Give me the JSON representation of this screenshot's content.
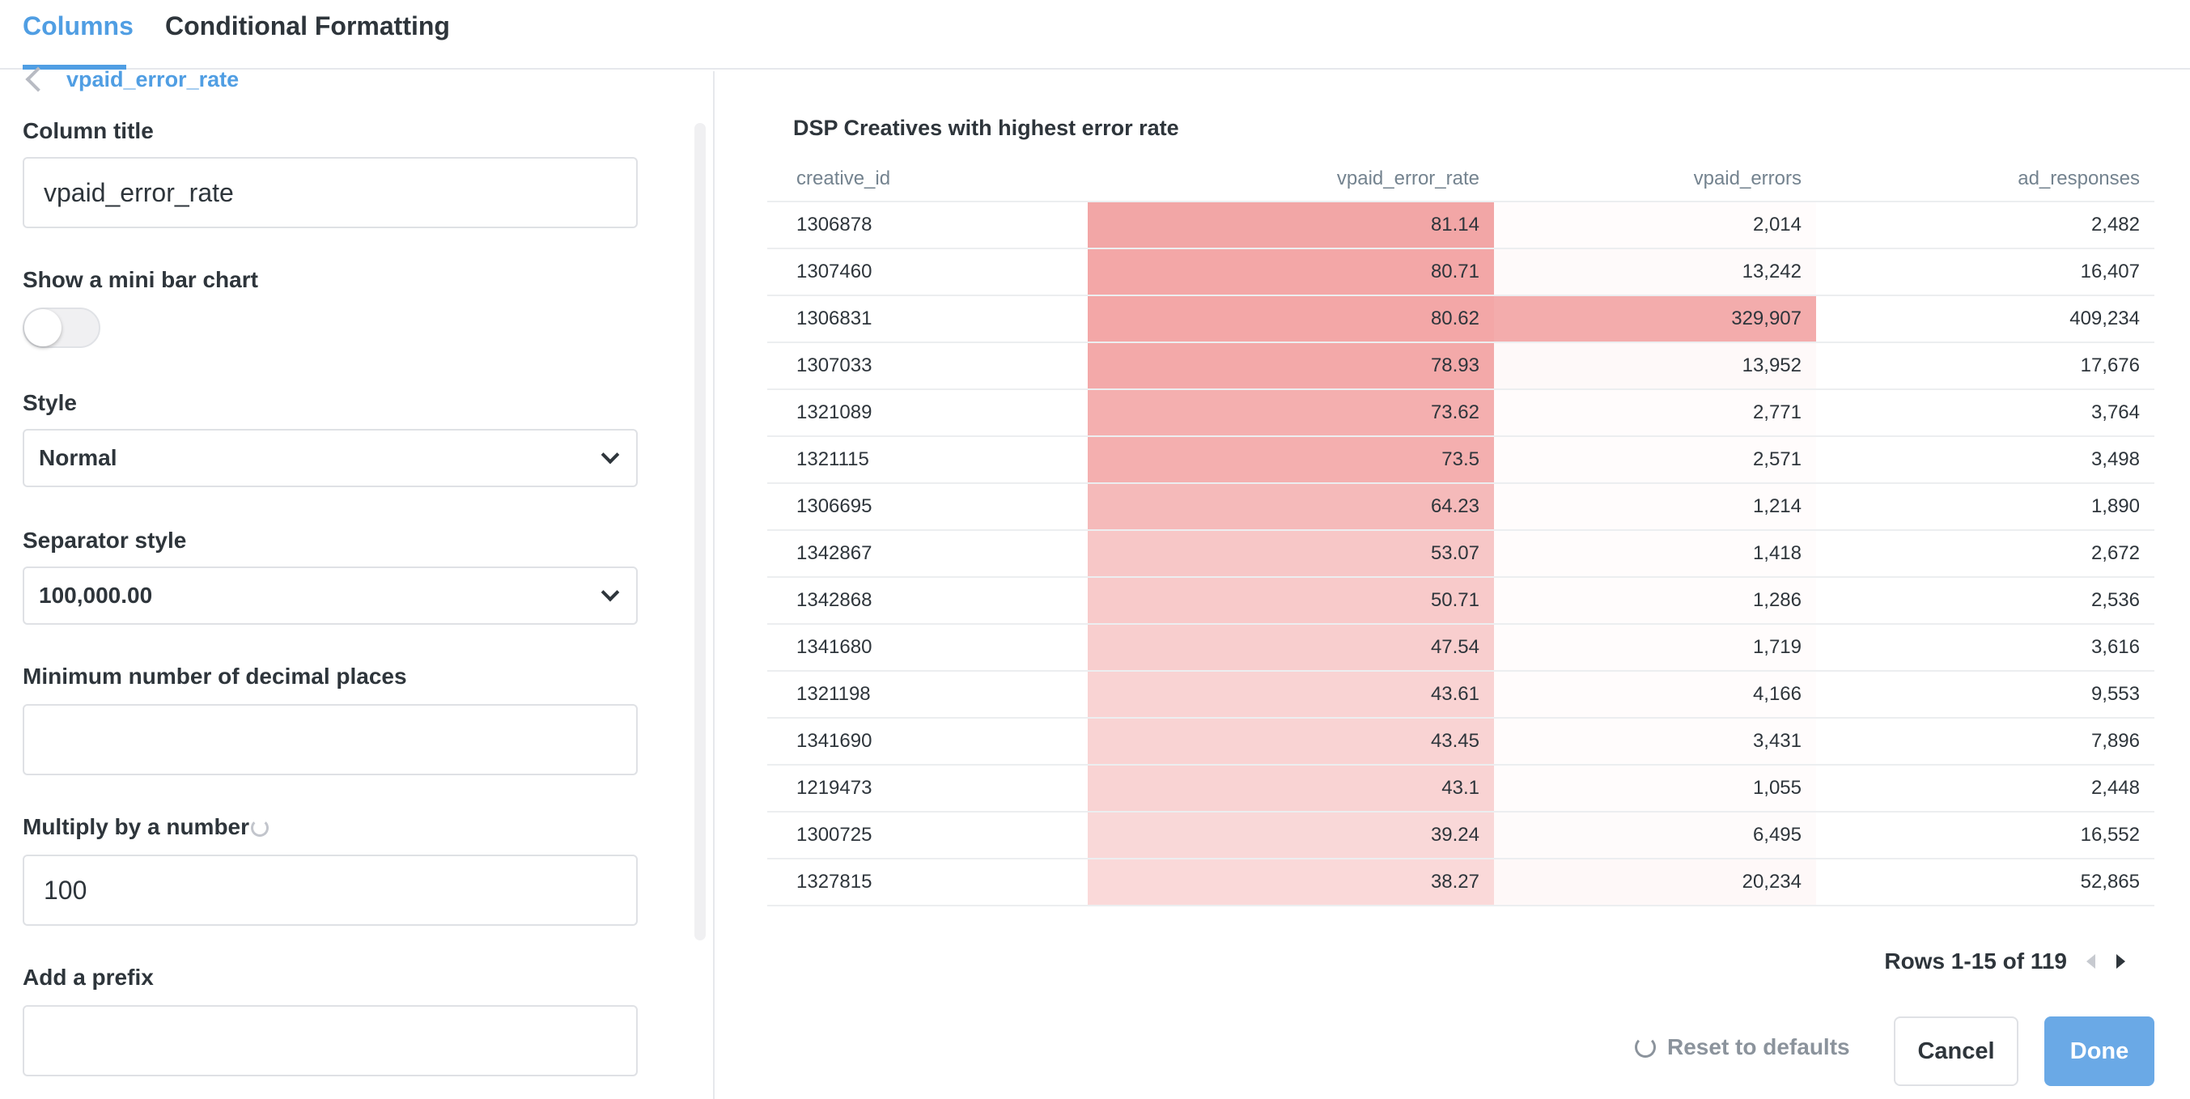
{
  "tabs": [
    {
      "label": "Columns",
      "active": true
    },
    {
      "label": "Conditional Formatting",
      "active": false
    }
  ],
  "settings": {
    "back_label": "vpaid_error_rate",
    "column_title_label": "Column title",
    "column_title_value": "vpaid_error_rate",
    "mini_bar_label": "Show a mini bar chart",
    "mini_bar_enabled": false,
    "style_label": "Style",
    "style_value": "Normal",
    "separator_label": "Separator style",
    "separator_value": "100,000.00",
    "decimals_label": "Minimum number of decimal places",
    "decimals_value": "",
    "multiply_label": "Multiply by a number",
    "multiply_value": "100",
    "prefix_label": "Add a prefix",
    "prefix_value": ""
  },
  "preview": {
    "title": "DSP Creatives with highest error rate",
    "columns": [
      "creative_id",
      "vpaid_error_rate",
      "vpaid_errors",
      "ad_responses"
    ],
    "rows": [
      [
        "1306878",
        "81.14",
        "2,014",
        "2,482"
      ],
      [
        "1307460",
        "80.71",
        "13,242",
        "16,407"
      ],
      [
        "1306831",
        "80.62",
        "329,907",
        "409,234"
      ],
      [
        "1307033",
        "78.93",
        "13,952",
        "17,676"
      ],
      [
        "1321089",
        "73.62",
        "2,771",
        "3,764"
      ],
      [
        "1321115",
        "73.5",
        "2,571",
        "3,498"
      ],
      [
        "1306695",
        "64.23",
        "1,214",
        "1,890"
      ],
      [
        "1342867",
        "53.07",
        "1,418",
        "2,672"
      ],
      [
        "1342868",
        "50.71",
        "1,286",
        "2,536"
      ],
      [
        "1341680",
        "47.54",
        "1,719",
        "3,616"
      ],
      [
        "1321198",
        "43.61",
        "4,166",
        "9,553"
      ],
      [
        "1341690",
        "43.45",
        "3,431",
        "7,896"
      ],
      [
        "1219473",
        "43.1",
        "1,055",
        "2,448"
      ],
      [
        "1300725",
        "39.24",
        "6,495",
        "16,552"
      ],
      [
        "1327815",
        "38.27",
        "20,234",
        "52,865"
      ]
    ],
    "pagination": "Rows 1-15 of 119"
  },
  "footer": {
    "reset_label": "Reset to defaults",
    "cancel_label": "Cancel",
    "done_label": "Done"
  },
  "colors": {
    "accent": "#509ee3",
    "heat": "#ed8080",
    "text": "#2e353b"
  },
  "icons": [
    "chevron-left-icon",
    "chevron-down-icon",
    "refresh-icon",
    "prev-page-icon",
    "next-page-icon"
  ]
}
